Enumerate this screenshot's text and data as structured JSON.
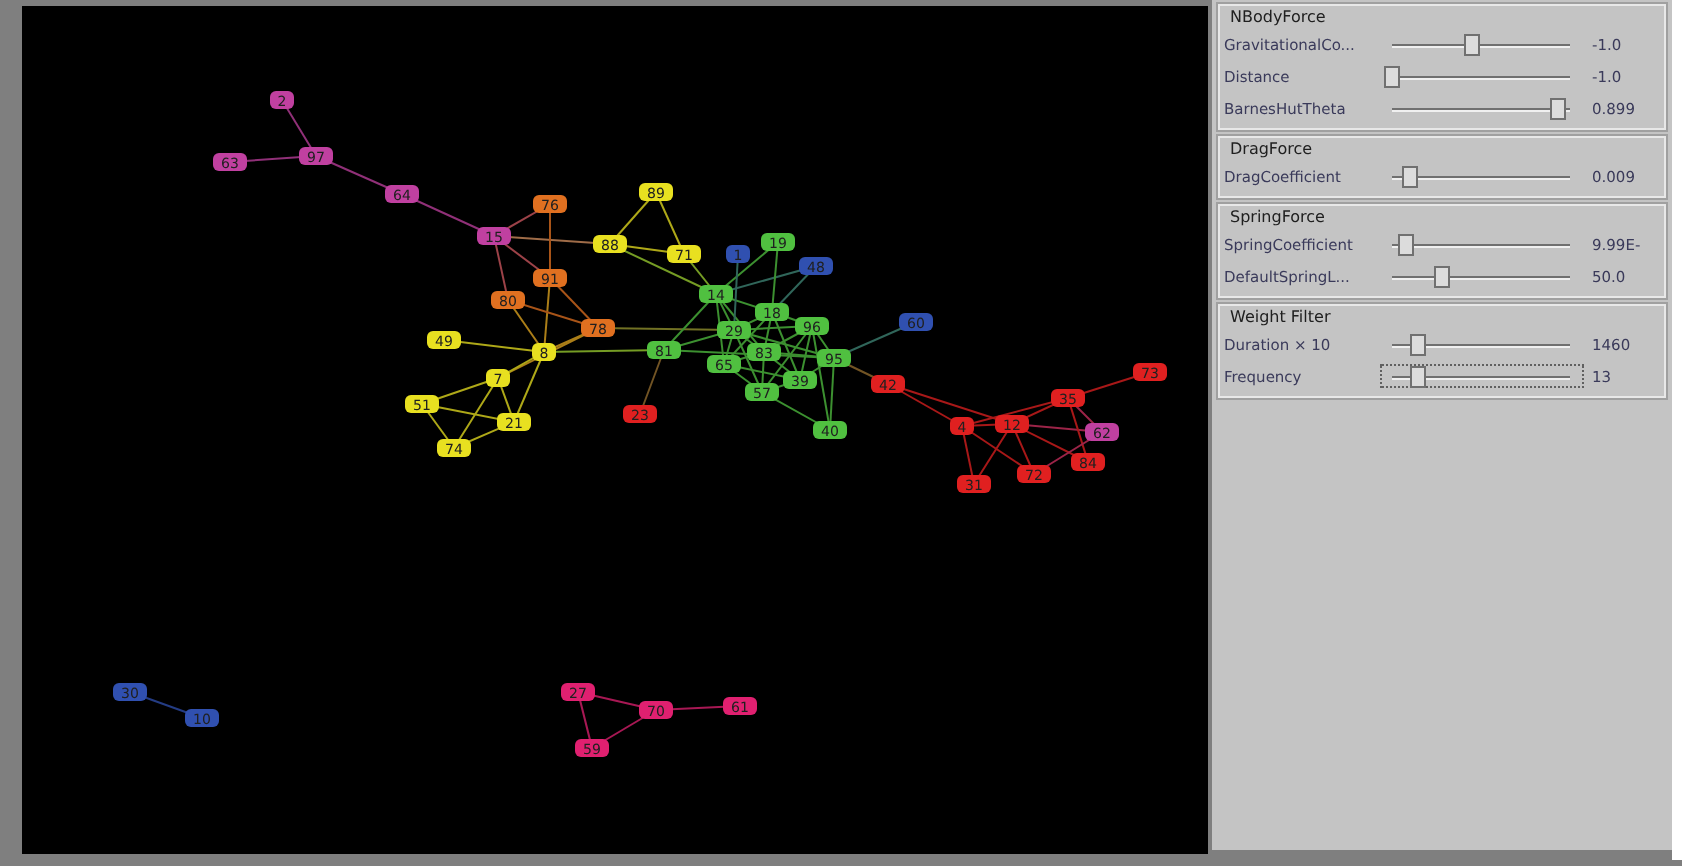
{
  "graph": {
    "nodes": [
      {
        "label": "2",
        "color": "#c040a0"
      },
      {
        "label": "97",
        "color": "#c040a0"
      },
      {
        "label": "63",
        "color": "#c040a0"
      },
      {
        "label": "64",
        "color": "#c040a0"
      },
      {
        "label": "15",
        "color": "#c040a0"
      },
      {
        "label": "76",
        "color": "#e07020"
      },
      {
        "label": "91",
        "color": "#e07020"
      },
      {
        "label": "80",
        "color": "#e07020"
      },
      {
        "label": "78",
        "color": "#e07020"
      },
      {
        "label": "89",
        "color": "#e8e020"
      },
      {
        "label": "88",
        "color": "#e8e020"
      },
      {
        "label": "71",
        "color": "#e8e020"
      },
      {
        "label": "49",
        "color": "#e8e020"
      },
      {
        "label": "8",
        "color": "#e8e020"
      },
      {
        "label": "7",
        "color": "#e8e020"
      },
      {
        "label": "51",
        "color": "#e8e020"
      },
      {
        "label": "21",
        "color": "#e8e020"
      },
      {
        "label": "74",
        "color": "#e8e020"
      },
      {
        "label": "81",
        "color": "#50c040"
      },
      {
        "label": "23",
        "color": "#e02020"
      },
      {
        "label": "14",
        "color": "#50c040"
      },
      {
        "label": "1",
        "color": "#3050b0"
      },
      {
        "label": "19",
        "color": "#50c040"
      },
      {
        "label": "48",
        "color": "#3050b0"
      },
      {
        "label": "18",
        "color": "#50c040"
      },
      {
        "label": "29",
        "color": "#50c040"
      },
      {
        "label": "96",
        "color": "#50c040"
      },
      {
        "label": "83",
        "color": "#50c040"
      },
      {
        "label": "65",
        "color": "#50c040"
      },
      {
        "label": "95",
        "color": "#50c040"
      },
      {
        "label": "39",
        "color": "#50c040"
      },
      {
        "label": "57",
        "color": "#50c040"
      },
      {
        "label": "40",
        "color": "#50c040"
      },
      {
        "label": "60",
        "color": "#3050b0"
      },
      {
        "label": "42",
        "color": "#e02020"
      },
      {
        "label": "4",
        "color": "#e02020"
      },
      {
        "label": "12",
        "color": "#e02020"
      },
      {
        "label": "35",
        "color": "#e02020"
      },
      {
        "label": "73",
        "color": "#e02020"
      },
      {
        "label": "62",
        "color": "#c040a0"
      },
      {
        "label": "84",
        "color": "#e02020"
      },
      {
        "label": "72",
        "color": "#e02020"
      },
      {
        "label": "31",
        "color": "#e02020"
      },
      {
        "label": "30",
        "color": "#3050b0"
      },
      {
        "label": "10",
        "color": "#3050b0"
      },
      {
        "label": "27",
        "color": "#e02070"
      },
      {
        "label": "70",
        "color": "#e02070"
      },
      {
        "label": "61",
        "color": "#e02070"
      },
      {
        "label": "59",
        "color": "#e02070"
      }
    ]
  },
  "panel": {
    "groups": [
      {
        "title": "NBodyForce",
        "sliders": [
          {
            "label": "GravitationalCo...",
            "value": "-1.0",
            "level": 0.45,
            "focused": false
          },
          {
            "label": "Distance",
            "value": "-1.0",
            "level": 0.0,
            "focused": false
          },
          {
            "label": "BarnesHutTheta",
            "value": "0.899",
            "level": 0.93,
            "focused": false
          }
        ]
      },
      {
        "title": "DragForce",
        "sliders": [
          {
            "label": "DragCoefficient",
            "value": "0.009",
            "level": 0.1,
            "focused": false
          }
        ]
      },
      {
        "title": "SpringForce",
        "sliders": [
          {
            "label": "SpringCoefficient",
            "value": "9.99E-",
            "level": 0.08,
            "focused": false
          },
          {
            "label": "DefaultSpringL...",
            "value": "50.0",
            "level": 0.28,
            "focused": false
          }
        ]
      },
      {
        "title": "Weight Filter",
        "sliders": [
          {
            "label": "Duration × 10",
            "value": "1460",
            "level": 0.15,
            "focused": false
          },
          {
            "label": "Frequency",
            "value": "13",
            "level": 0.15,
            "focused": true
          }
        ]
      }
    ]
  }
}
